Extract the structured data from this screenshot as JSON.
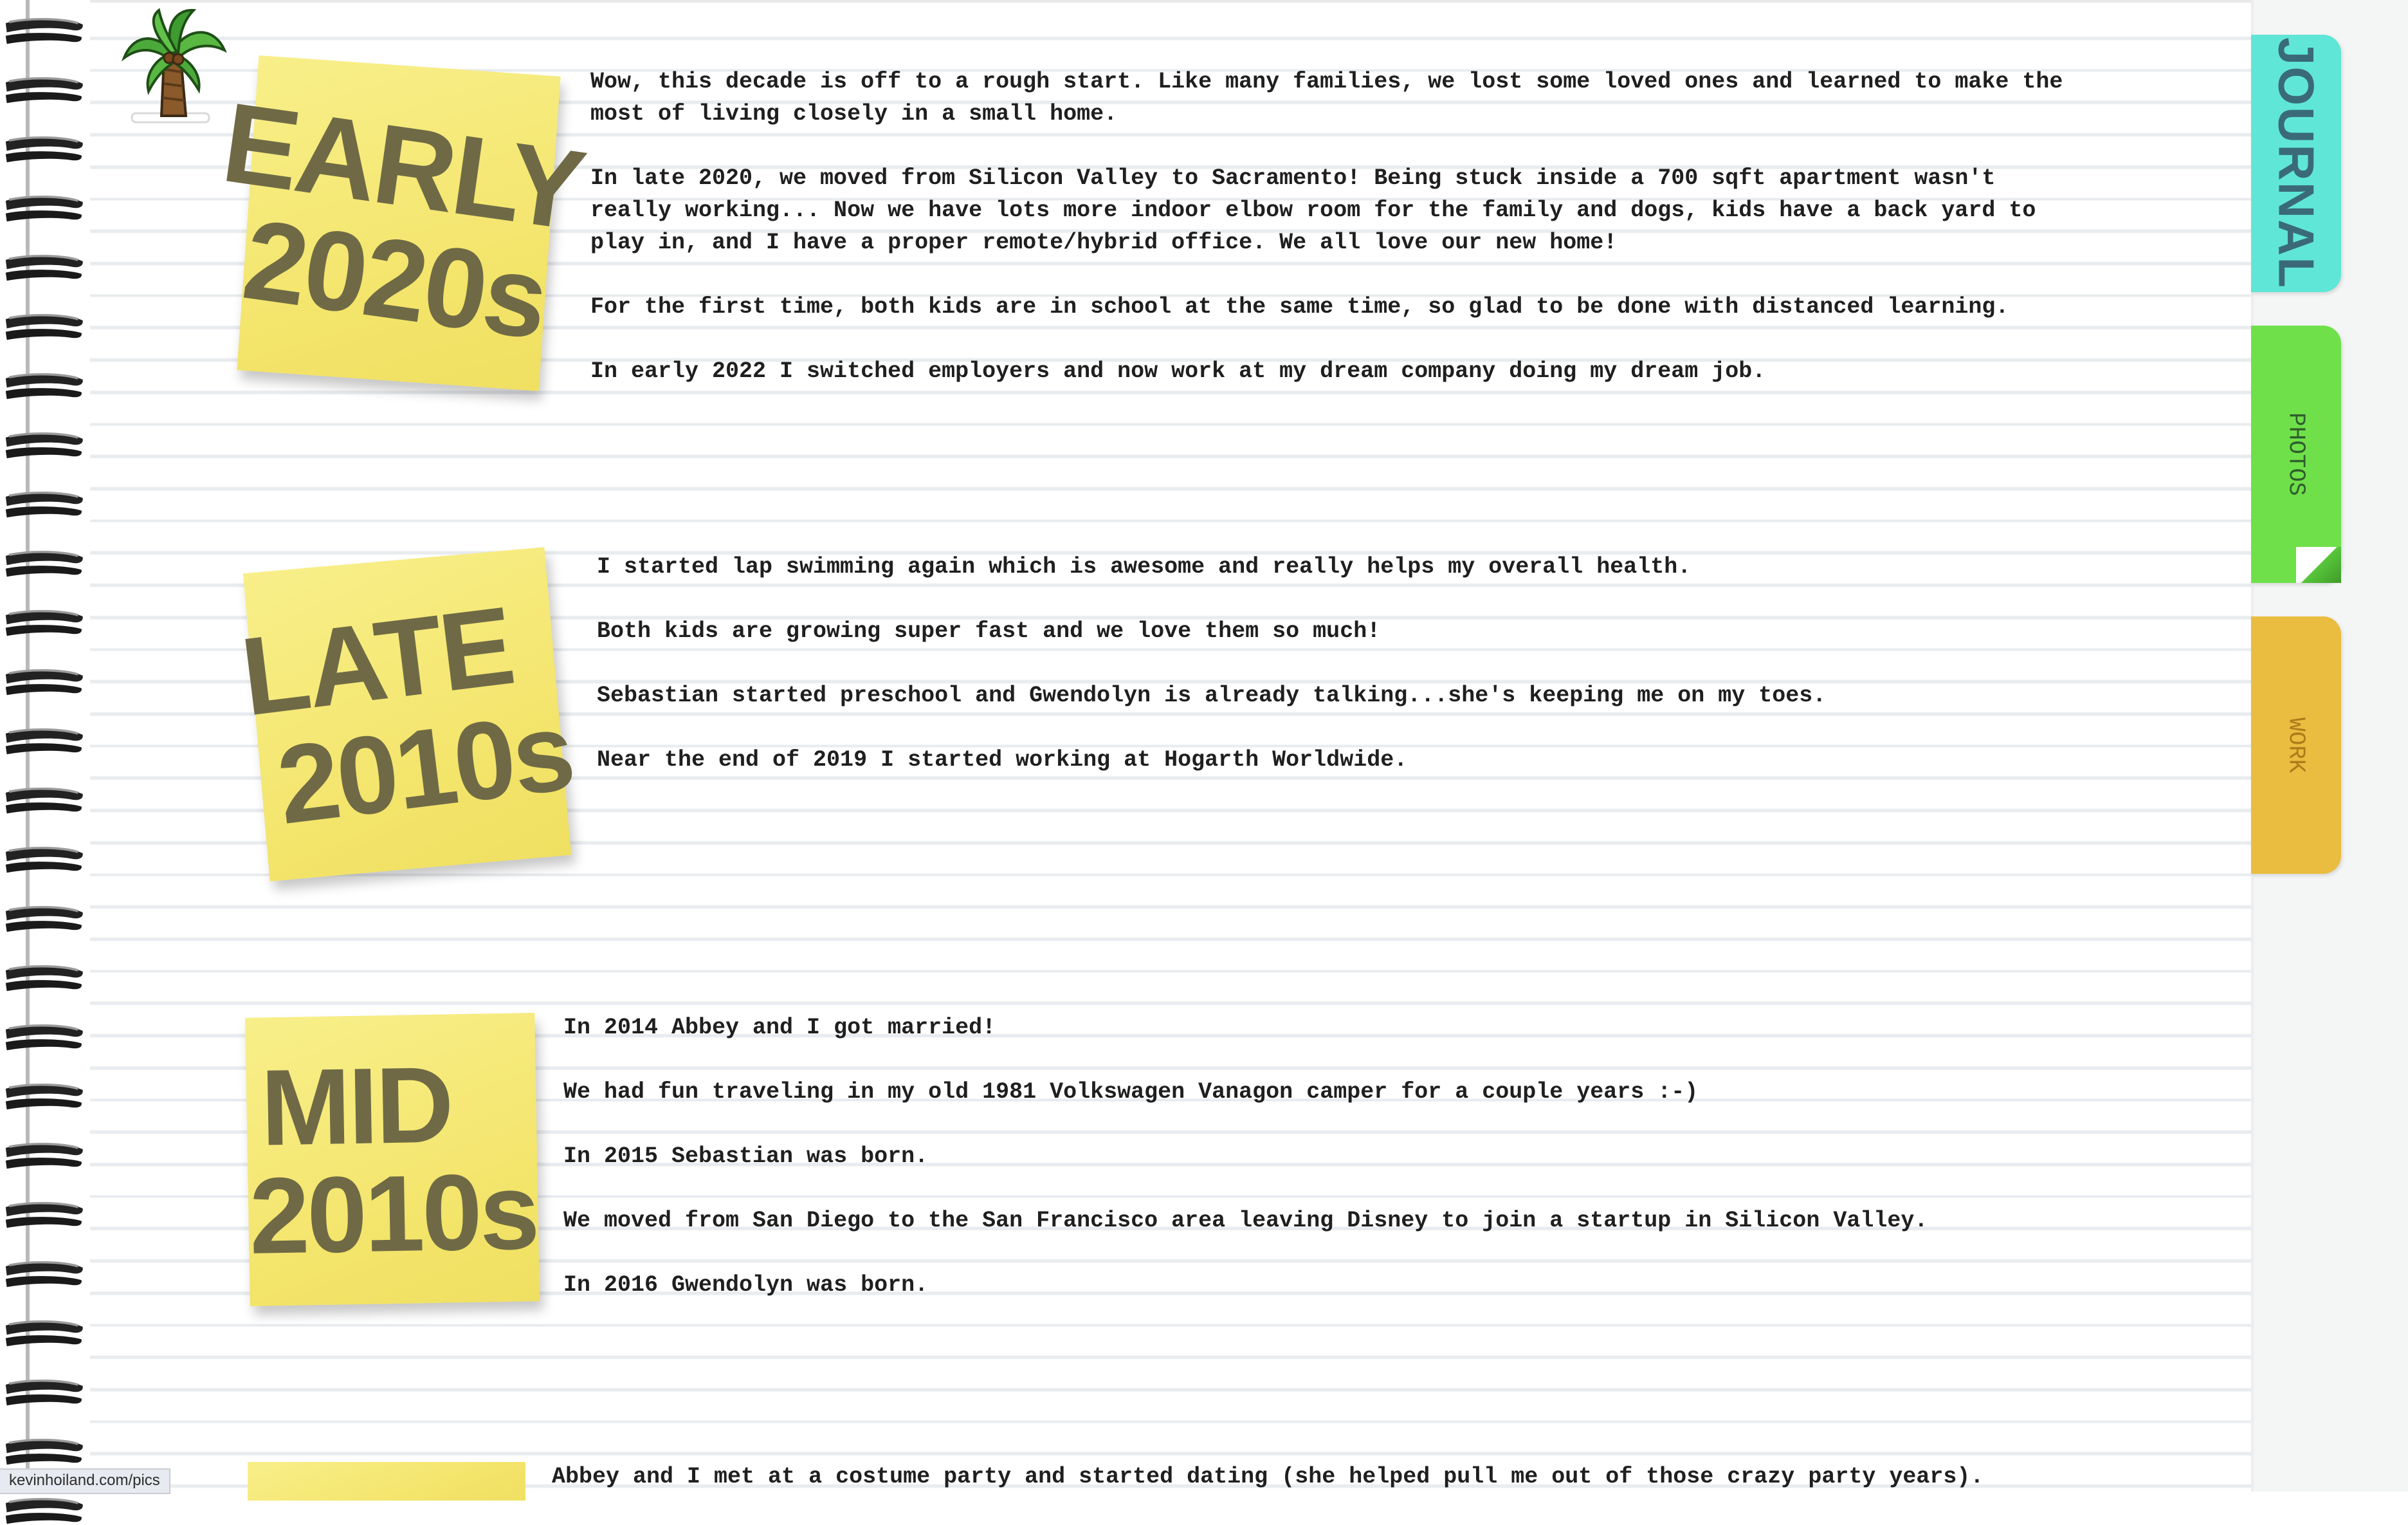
{
  "sections": [
    {
      "note_lines": [
        "EARLY",
        "2020s"
      ],
      "paragraphs": [
        "Wow, this decade is off to a rough start. Like many families, we lost some loved ones and learned to make the\nmost of living closely in a small home.",
        "In late 2020, we moved from Silicon Valley to Sacramento! Being stuck inside a 700 sqft apartment wasn't\nreally working... Now we have lots more indoor elbow room for the family and dogs, kids have a back yard to\nplay in, and I have a proper remote/hybrid office. We all love our new home!",
        "For the first time, both kids are in school at the same time, so glad to be done with distanced learning.",
        "In early 2022 I switched employers and now work at my dream company doing my dream job."
      ]
    },
    {
      "note_lines": [
        "LATE",
        "2010s"
      ],
      "paragraphs": [
        "I started lap swimming again which is awesome and really helps my overall health.",
        "Both kids are growing super fast and we love them so much!",
        "Sebastian started preschool and Gwendolyn is already talking...she's keeping me on my toes.",
        "Near the end of 2019 I started working at Hogarth Worldwide."
      ]
    },
    {
      "note_lines": [
        "MID",
        "2010s"
      ],
      "paragraphs": [
        "In 2014 Abbey and I got married!",
        "We had fun traveling in my old 1981 Volkswagen Vanagon camper for a couple years :-)",
        "In 2015 Sebastian was born.",
        "We moved from San Diego to the San Francisco area leaving Disney to join a startup in Silicon Valley.",
        "In 2016 Gwendolyn was born."
      ]
    },
    {
      "paragraphs": [
        "Abbey and I met at a costume party and started dating (she helped pull me out of those crazy party years)."
      ]
    }
  ],
  "tabs": {
    "journal": "JOURNAL",
    "photos": "PHOTOS",
    "work": "WORK"
  },
  "status_bar_url": "kevinhoiland.com/pics",
  "colors": {
    "sticky_note": "#f5e972",
    "tab_journal": "#5fe6d6",
    "tab_photos": "#6fe04a",
    "tab_work": "#eabd40"
  },
  "icons": [
    "palm-tree-icon",
    "spiral-binding-icon"
  ]
}
